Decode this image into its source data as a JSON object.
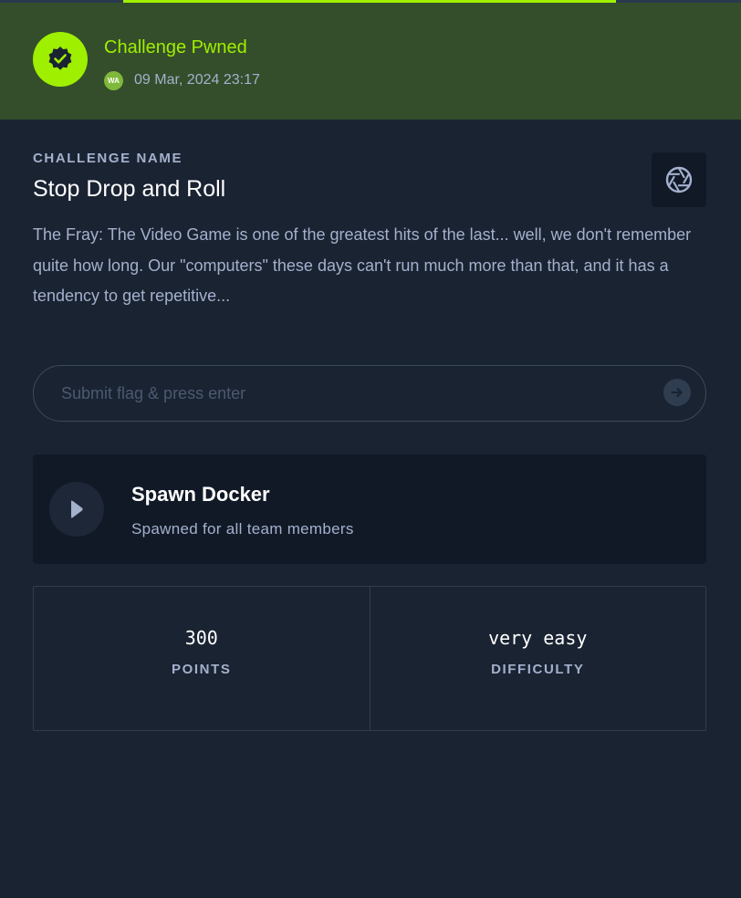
{
  "banner": {
    "title": "Challenge Pwned",
    "user_initials": "WA",
    "date": "09 Mar, 2024 23:17",
    "badge_icon": "verified-check-icon",
    "accent_color": "#9fef00"
  },
  "challenge": {
    "label": "CHALLENGE NAME",
    "name": "Stop Drop and Roll",
    "description": "The Fray: The Video Game is one of the greatest hits of the last... well, we don't remember quite how long. Our \"computers\" these days can't run much more than that, and it has a tendency to get repetitive...",
    "category_icon": "shutter-icon"
  },
  "flag": {
    "placeholder": "Submit flag & press enter",
    "value": "",
    "submit_icon": "arrow-right-icon"
  },
  "spawn": {
    "title": "Spawn Docker",
    "subtitle": "Spawned for all team members",
    "icon": "play-icon"
  },
  "stats": {
    "points_value": "300",
    "points_label": "POINTS",
    "difficulty_value": "very easy",
    "difficulty_label": "DIFFICULTY"
  }
}
